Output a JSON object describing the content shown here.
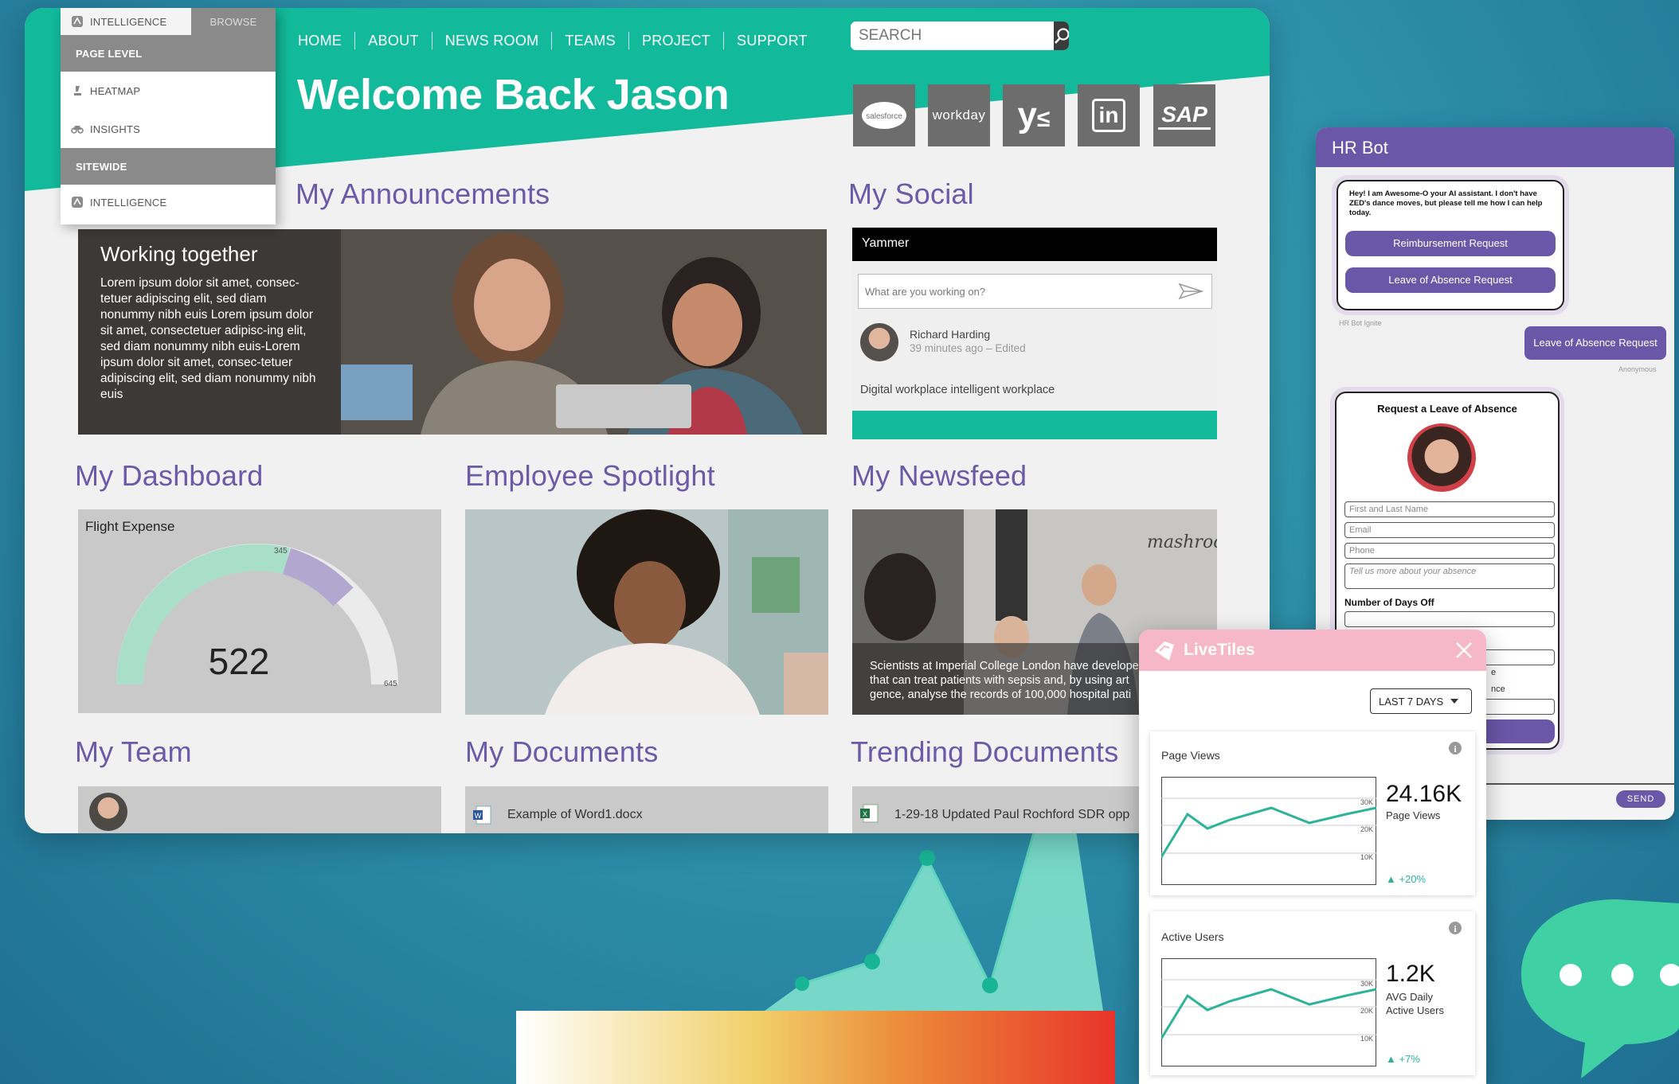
{
  "nav": {
    "items": [
      "HOME",
      "ABOUT",
      "NEWS ROOM",
      "TEAMS",
      "PROJECT",
      "SUPPORT"
    ]
  },
  "search": {
    "placeholder": "SEARCH"
  },
  "welcome": "Welcome Back Jason",
  "apps": [
    {
      "label": "salesforce",
      "icon": "salesforce-icon"
    },
    {
      "label": "workday",
      "icon": "workday-icon"
    },
    {
      "label": "y",
      "icon": "yammer-icon"
    },
    {
      "label": "in",
      "icon": "linkedin-icon"
    },
    {
      "label": "SAP",
      "icon": "sap-icon"
    }
  ],
  "menu": {
    "tab_active": "INTELLIGENCE",
    "tab_other": "BROWSE",
    "page_level": "PAGE LEVEL",
    "heatmap": "HEATMAP",
    "insights": "INSIGHTS",
    "sitewide": "SITEWIDE",
    "intelligence": "INTELLIGENCE"
  },
  "sections": {
    "announcements": "My Announcements",
    "social": "My Social",
    "dashboard": "My Dashboard",
    "spotlight": "Employee Spotlight",
    "newsfeed": "My Newsfeed",
    "team": "My Team",
    "documents": "My Documents",
    "trending": "Trending Documents"
  },
  "announcement": {
    "title": "Working together",
    "body": "Lorem ipsum dolor sit amet, consec-tetuer adipiscing elit, sed diam nonummy nibh euis Lorem ipsum dolor sit amet, consectetuer adipisc-ing elit, sed diam nonummy nibh euis-Lorem ipsum dolor sit amet, consec-tetuer adipiscing elit, sed diam nonummy nibh euis"
  },
  "social": {
    "header": "Yammer",
    "input_placeholder": "What are you working on?",
    "post_author": "Richard Harding",
    "post_time": "39 minutes ago",
    "post_edited": "Edited",
    "post_sep": "–",
    "post_text": "Digital workplace intelligent workplace"
  },
  "dashboard": {
    "title": "Flight Expense",
    "value": "522",
    "marker": "345",
    "max": "645",
    "value_num": 522,
    "marker_num": 345,
    "max_num": 645
  },
  "newsfeed": {
    "caption": "Scientists at Imperial College London have developed that can treat patients with sepsis and, by using art gence, analyse the records of 100,000 hospital pati"
  },
  "documents": {
    "item": "Example of Word1.docx"
  },
  "trending": {
    "item": "1-29-18 Updated Paul Rochford SDR opp"
  },
  "hrbot": {
    "title": "HR Bot",
    "greeting": "Hey! I am Awesome-O your AI assistant. I don't have ZED's dance moves, but please tell me how I can help today.",
    "btn_reimburse": "Reimbursement Request",
    "btn_leave": "Leave of Absence Request",
    "bot_caption": "HR Bot Ignite",
    "user_msg": "Leave of Absence Request",
    "user_caption": "Anonymous",
    "form_title": "Request a Leave of Absence",
    "f_name": "First and Last Name",
    "f_email": "Email",
    "f_phone": "Phone",
    "f_tell": "Tell us more about your absence",
    "days_label": "Number of Days Off",
    "partial1": "e",
    "partial2": "nce",
    "send": "SEND"
  },
  "livetiles": {
    "brand": "LiveTiles",
    "range": "LAST 7 DAYS",
    "tiles": [
      {
        "title": "Page Views",
        "value": "24.16K",
        "sub": "Page Views",
        "delta": "+20%",
        "ticks": [
          "30K",
          "20K",
          "10K"
        ]
      },
      {
        "title": "Active Users",
        "value": "1.2K",
        "sub": "AVG Daily Active Users",
        "delta": "+7%",
        "ticks": [
          "30K",
          "20K",
          "10K"
        ]
      }
    ]
  },
  "colors": {
    "teal": "#12b99a",
    "purple": "#6a5aa7",
    "pink": "#f6b8c8",
    "dark": "#3b3b3b"
  }
}
